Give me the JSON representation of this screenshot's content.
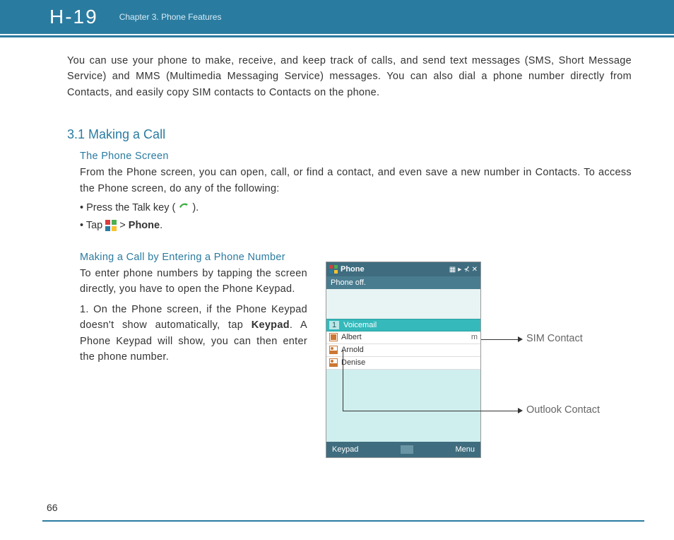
{
  "header": {
    "brand": "H-19",
    "chapter": "Chapter 3. Phone Features"
  },
  "intro": "You can use your phone to make, receive, and keep track of calls, and send text messages (SMS, Short Message Service) and MMS (Multimedia Messaging Service) messages. You can also dial a phone number directly from Contacts, and easily copy SIM contacts to Contacts on the phone.",
  "section": {
    "title": "3.1 Making a Call",
    "sub1_title": "The Phone Screen",
    "sub1_body": "From the Phone screen, you can open, call, or find a contact, and even save a new number in Contacts. To access the Phone screen, do any of the following:",
    "bullet1_pre": "• Press the Talk key ( ",
    "bullet1_post": " ).",
    "bullet2_pre": "• Tap ",
    "bullet2_mid": "  > ",
    "bullet2_bold": "Phone",
    "bullet2_post": ".",
    "sub2_title": "Making a Call by Entering a Phone Number",
    "sub2_body": "To enter phone numbers by tapping the screen directly, you have to open the Phone Keypad.",
    "step1_pre": "1. On the Phone screen, if the Phone Keypad doesn't show automatically, tap ",
    "step1_bold": "Keypad",
    "step1_post": ". A Phone Keypad will show, you can then enter the phone number."
  },
  "phone": {
    "title": "Phone",
    "status": "Phone off.",
    "voicemail_num": "1",
    "voicemail": "Voicemail",
    "contacts": [
      "Albert",
      "Arnold",
      "Denise"
    ],
    "row_m": "m",
    "soft_left": "Keypad",
    "soft_right": "Menu"
  },
  "callouts": {
    "sim": "SIM Contact",
    "outlook": "Outlook Contact"
  },
  "page_number": "66"
}
